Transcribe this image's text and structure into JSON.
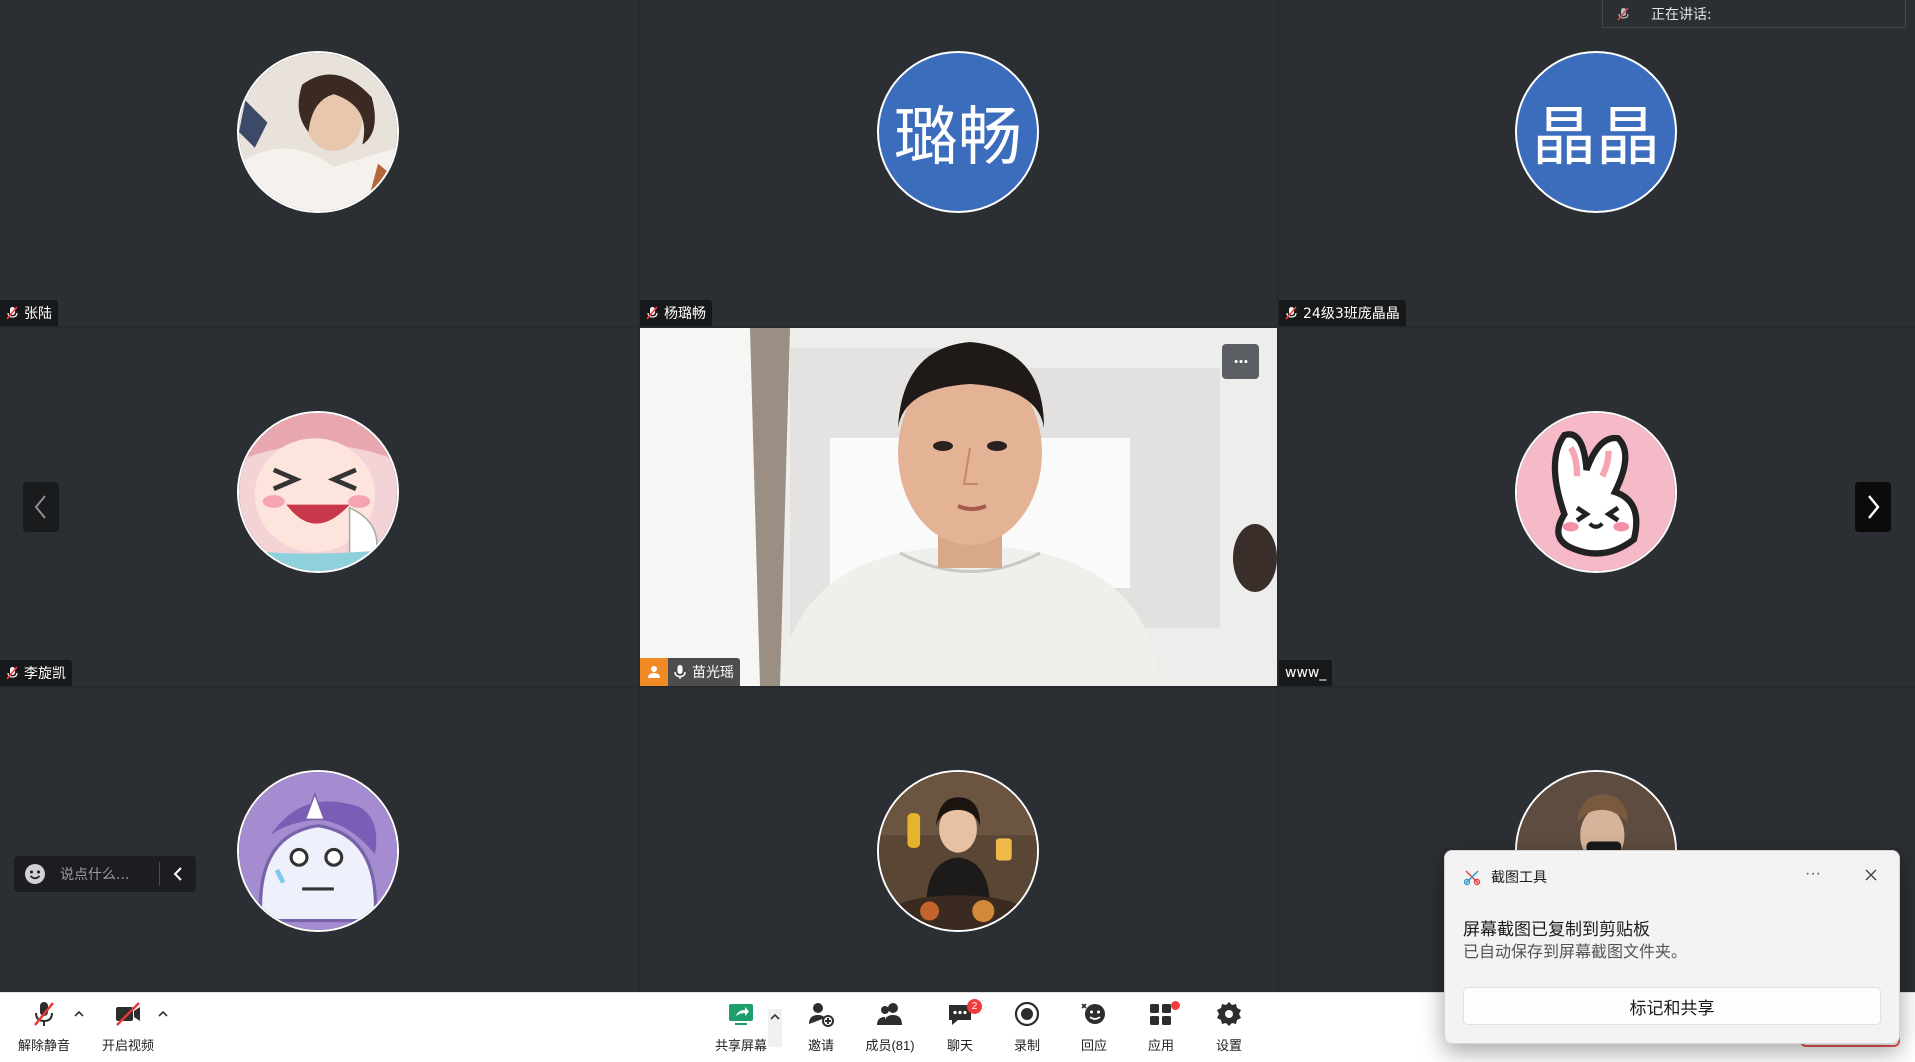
{
  "speaking": {
    "label": "正在讲话:"
  },
  "participants": [
    {
      "name": "张陆",
      "avatar_type": "photo",
      "muted": true
    },
    {
      "name": "杨璐畅",
      "avatar_type": "text",
      "avatar_text": "璐畅",
      "muted": true
    },
    {
      "name": "24级3班庞晶晶",
      "avatar_type": "text",
      "avatar_text": "晶晶",
      "muted": true
    },
    {
      "name": "李旋凯",
      "avatar_type": "cartoon",
      "muted": true
    },
    {
      "name": "苗光瑶",
      "avatar_type": "video",
      "muted": false,
      "host": true
    },
    {
      "name": "www_",
      "avatar_type": "cartoon-bunny",
      "muted": false
    },
    {
      "name": "",
      "avatar_type": "cartoon-unicorn"
    },
    {
      "name": "",
      "avatar_type": "photo"
    },
    {
      "name": "",
      "avatar_type": "photo"
    }
  ],
  "chat_input": {
    "placeholder": "说点什么..."
  },
  "toolbar": {
    "unmute": "解除静音",
    "start_video": "开启视频",
    "share_screen": "共享屏幕",
    "invite": "邀请",
    "members": "成员(81)",
    "chat": "聊天",
    "chat_badge": "2",
    "record": "录制",
    "reaction": "回应",
    "apps": "应用",
    "settings": "设置"
  },
  "toast": {
    "app_name": "截图工具",
    "more": "···",
    "title": "屏幕截图已复制到剪贴板",
    "subtitle": "已自动保存到屏幕截图文件夹。",
    "action": "标记和共享"
  },
  "colors": {
    "tile_bg": "#2b2e33",
    "text_avatar_blue": "#3c6dbd",
    "badge_red": "#f03c3c",
    "host_orange": "#f08a24"
  }
}
